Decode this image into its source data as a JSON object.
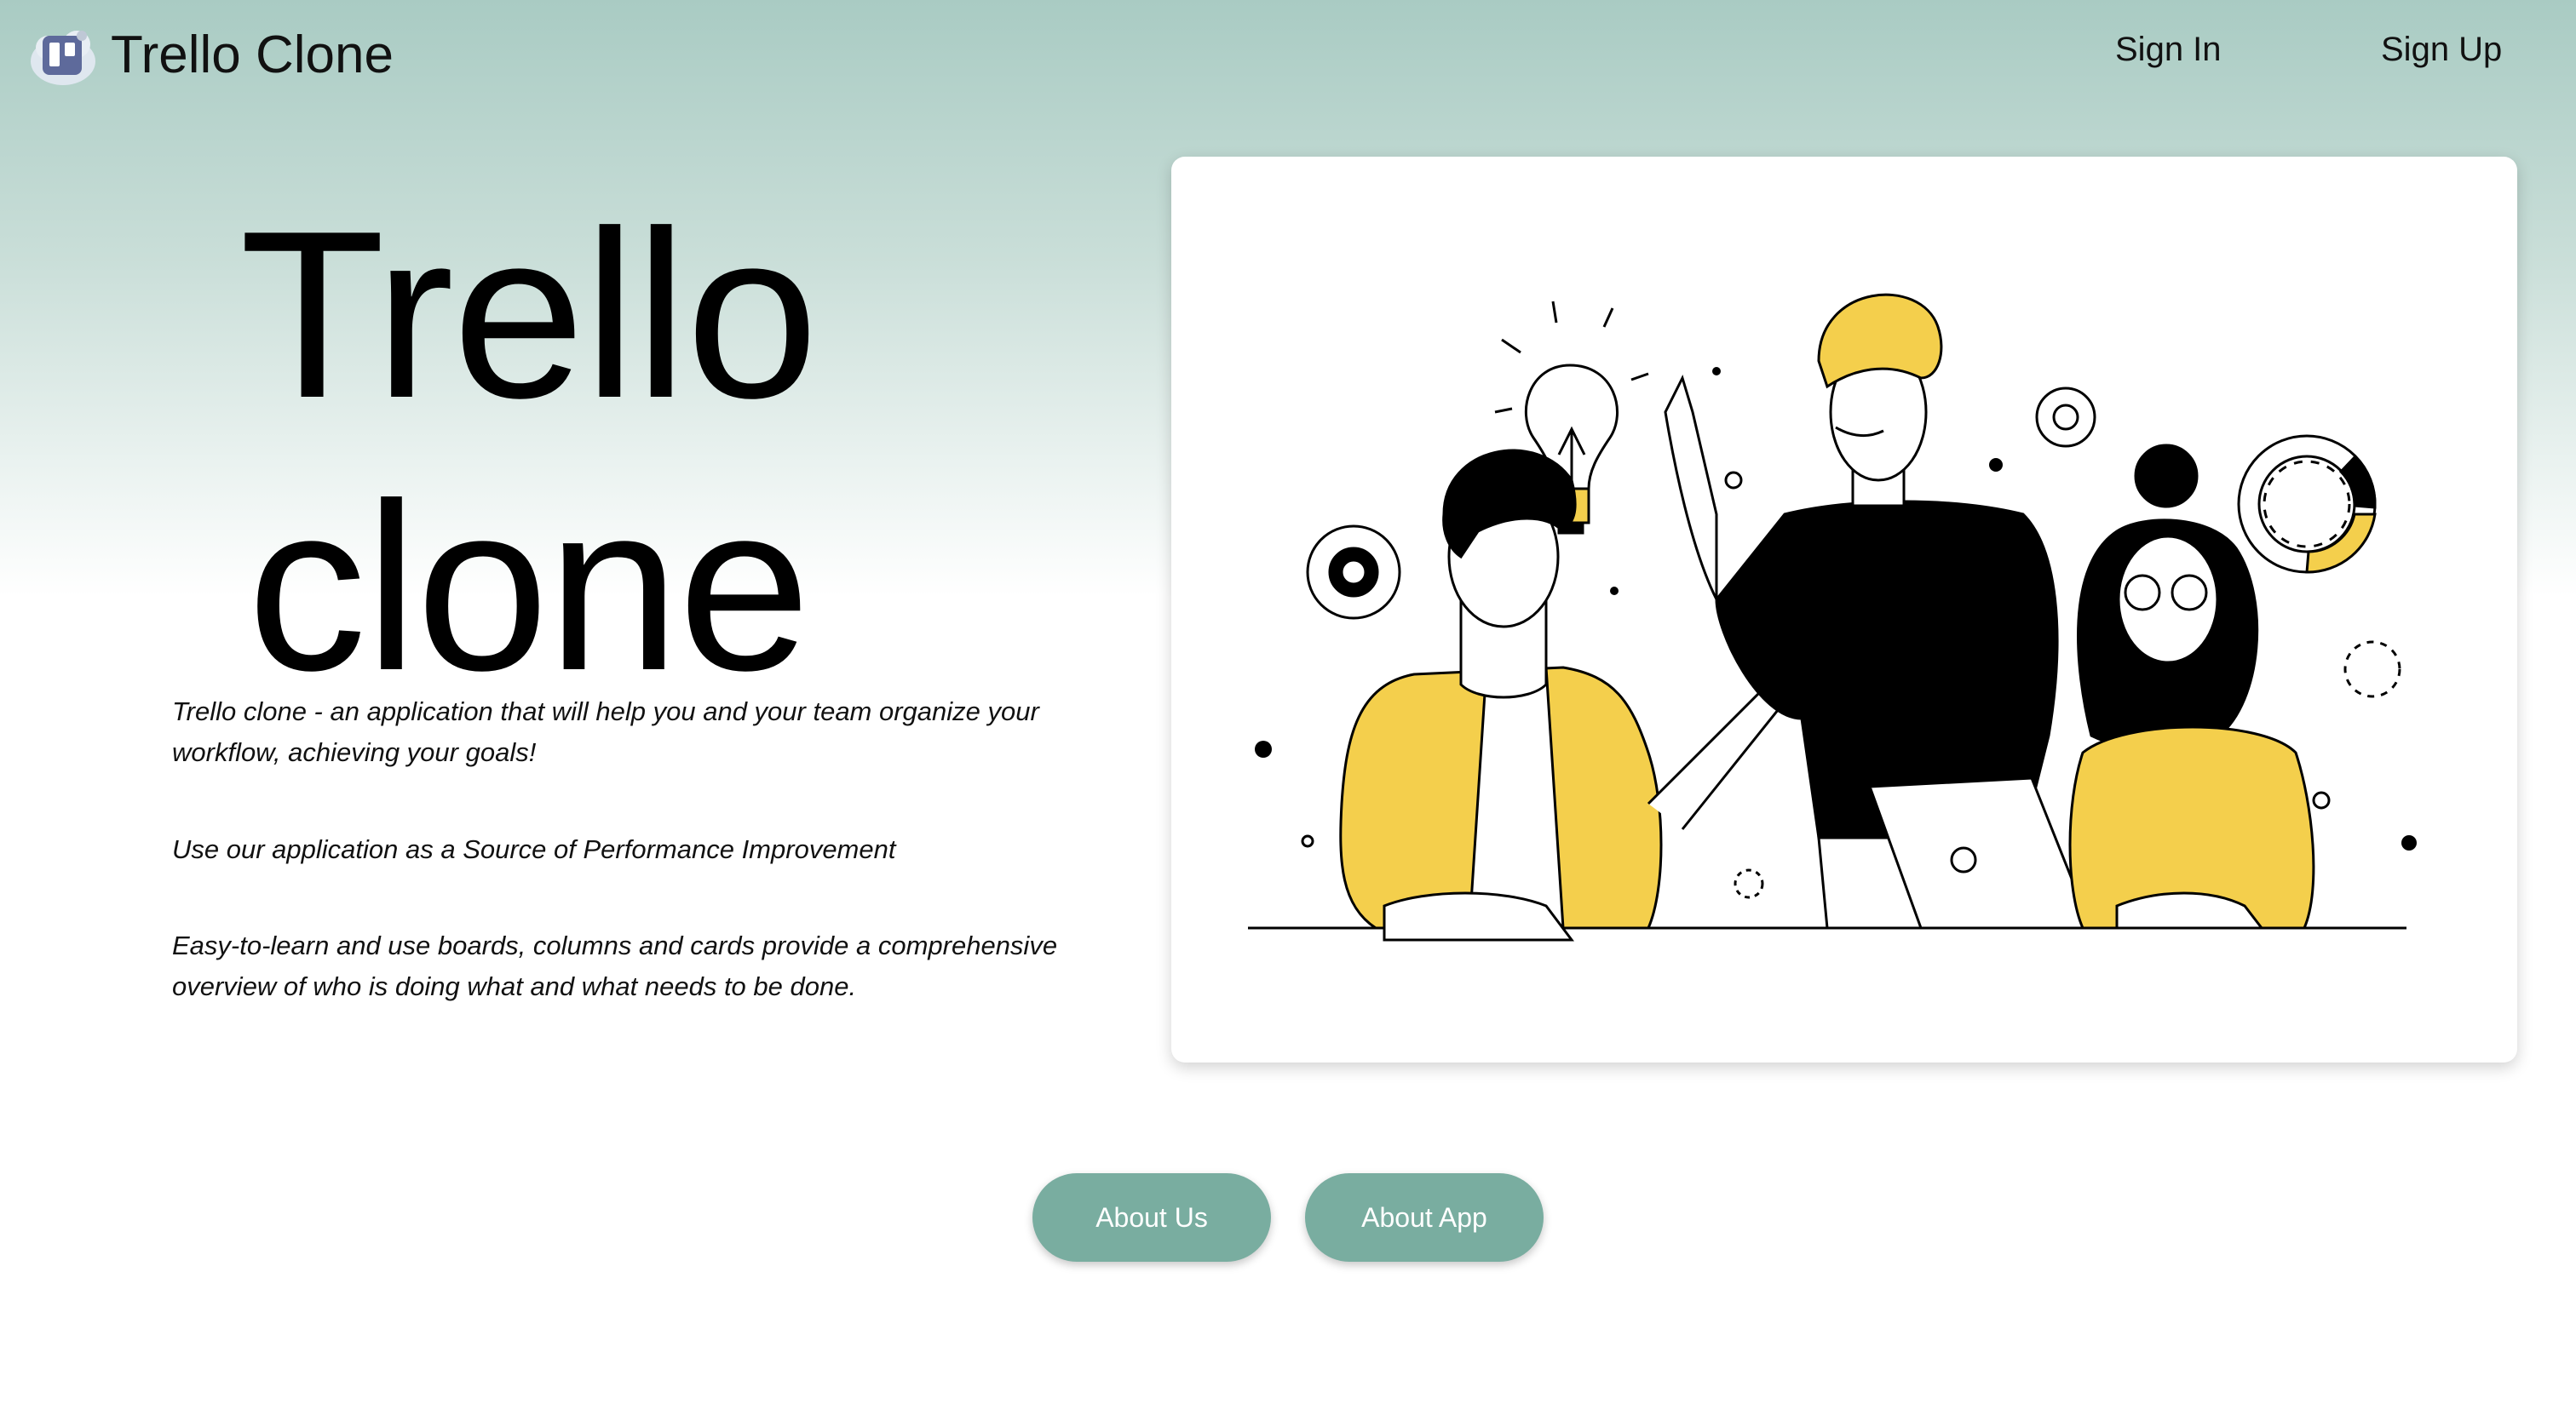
{
  "header": {
    "app_title": "Trello Clone",
    "sign_in": "Sign In",
    "sign_up": "Sign Up"
  },
  "hero": {
    "title_line1": "Trello",
    "title_line2": "clone",
    "paragraphs": [
      "Trello clone - an application that will help you and your team organize your workflow, achieving your goals!",
      "Use our application as a Source of Performance Improvement",
      "Easy-to-learn and use boards, columns and cards provide a comprehensive overview of who is doing what and what needs to be done."
    ]
  },
  "actions": {
    "about_us": "About Us",
    "about_app": "About App"
  },
  "colors": {
    "accent": "#79ada0",
    "header_gradient_top": "#a9cbc3",
    "illustration_yellow": "#f4cf4c",
    "illustration_black": "#000000"
  },
  "icons": {
    "logo": "trello-board-icon",
    "illustration": "team-brainstorm-illustration"
  }
}
